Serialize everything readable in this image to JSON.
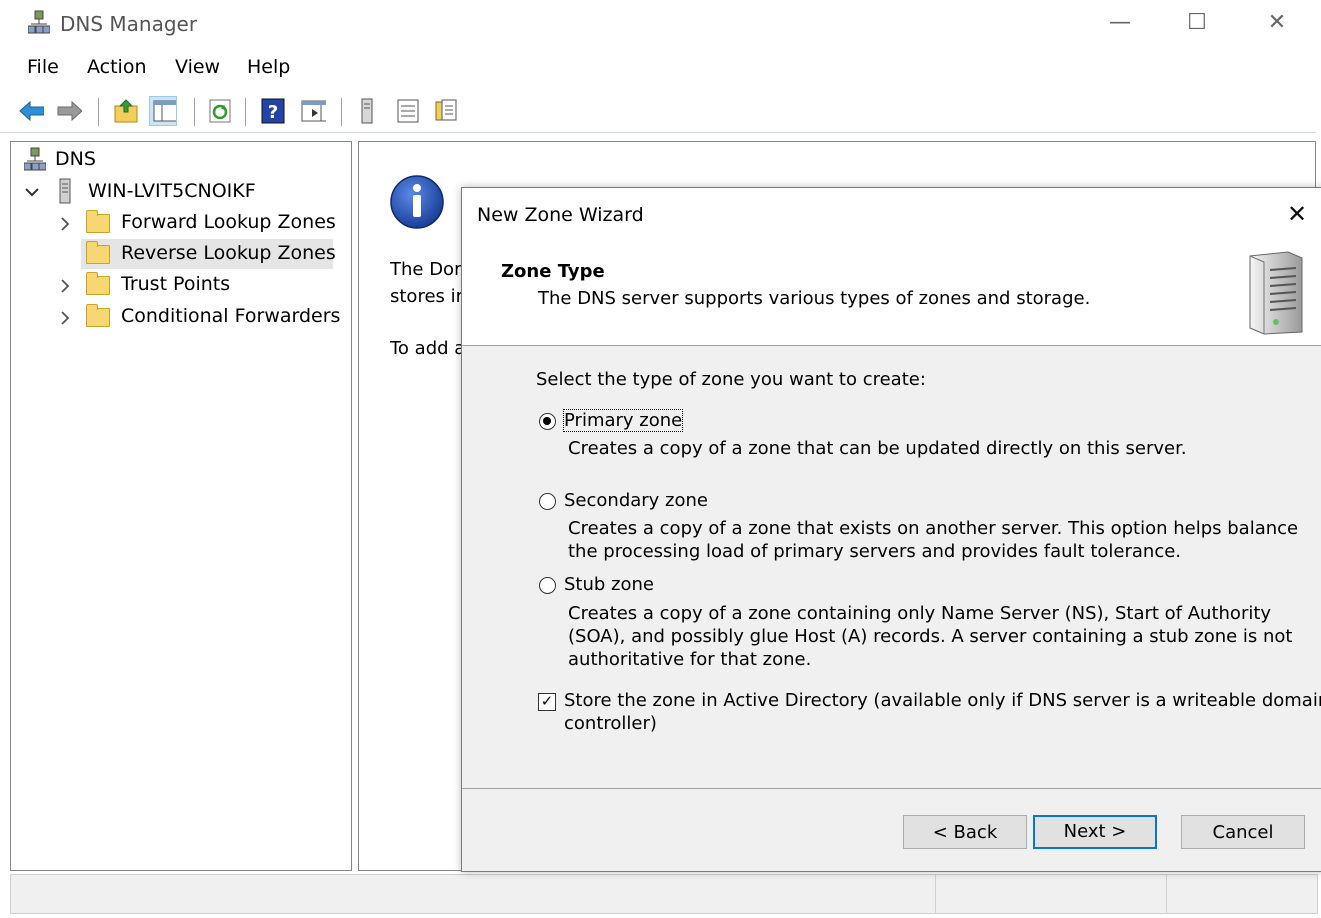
{
  "window": {
    "title": "DNS Manager",
    "minimize_glyph": "—",
    "maximize_glyph": "☐",
    "close_glyph": "✕"
  },
  "menu": {
    "items": [
      {
        "label": "File"
      },
      {
        "label": "Action"
      },
      {
        "label": "View"
      },
      {
        "label": "Help"
      }
    ]
  },
  "toolbar": {
    "icons": [
      "back-arrow-icon",
      "forward-arrow-icon",
      "up-folder-icon",
      "show-hide-tree-icon",
      "refresh-icon",
      "help-icon",
      "action-pane-icon",
      "server-icon",
      "list-icon",
      "properties-icon"
    ]
  },
  "tree": {
    "root": {
      "label": "DNS",
      "icon": "dns-icon"
    },
    "server": {
      "label": "WIN-LVIT5CNOIKF",
      "expanded_glyph": "⌄"
    },
    "children": [
      {
        "label": "Forward Lookup Zones",
        "has_children": true,
        "selected": false
      },
      {
        "label": "Reverse Lookup Zones",
        "has_children": false,
        "selected": true
      },
      {
        "label": "Trust Points",
        "has_children": true,
        "selected": false
      },
      {
        "label": "Conditional Forwarders",
        "has_children": true,
        "selected": false
      }
    ],
    "collapsed_glyph": "›"
  },
  "right_pane": {
    "info_glyph": "i",
    "line1": "The Dor",
    "line2": "stores ir",
    "line3": "To add a"
  },
  "dialog": {
    "title": "New Zone Wizard",
    "close_glyph": "✕",
    "heading": "Zone Type",
    "subheading": "The DNS server supports various types of zones and storage.",
    "prompt": "Select the type of zone you want to create:",
    "options": [
      {
        "label": "Primary zone",
        "selected": true,
        "desc": [
          "Creates a copy of a zone that can be updated directly on this server."
        ]
      },
      {
        "label": "Secondary zone",
        "selected": false,
        "desc": [
          "Creates a copy of a zone that exists on another server. This option helps balance",
          "the processing load of primary servers and provides fault tolerance."
        ]
      },
      {
        "label": "Stub zone",
        "selected": false,
        "desc": [
          "Creates a copy of a zone containing only Name Server (NS), Start of Authority",
          "(SOA), and possibly glue Host (A) records. A server containing a stub zone is not",
          "authoritative for that zone."
        ]
      }
    ],
    "store_ad": {
      "checked": true,
      "check_glyph": "✓",
      "line1": "Store the zone in Active Directory (available only if DNS server is a writeable domain",
      "line2": "controller)"
    },
    "buttons": {
      "back": "< Back",
      "next": "Next >",
      "cancel": "Cancel"
    }
  },
  "colors": {
    "accent": "#0078d7",
    "selection": "#e5e5e5",
    "folder": "#f7d774",
    "info_blue": "#1f5fbf"
  }
}
